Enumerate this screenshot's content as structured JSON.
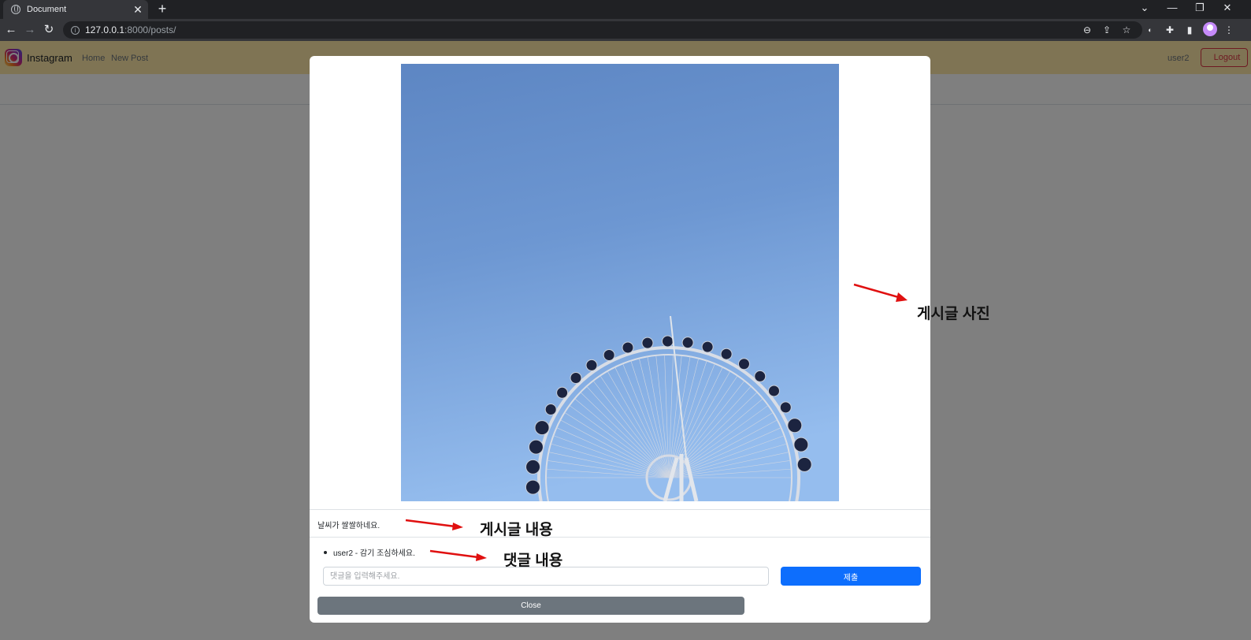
{
  "browser": {
    "tab_title": "Document",
    "tab_close": "✕",
    "new_tab": "+",
    "url_host": "127.0.0.1",
    "url_rest": ":8000/posts/"
  },
  "site": {
    "brand": "Instagram",
    "nav": [
      "Home",
      "New Post"
    ],
    "username": "user2",
    "logout_label": "Logout"
  },
  "modal": {
    "post_content": "날씨가 쌀쌀하네요.",
    "comments": [
      {
        "text": "user2 - 감기 조심하세요."
      }
    ],
    "comment_placeholder": "댓글을 입력해주세요.",
    "submit_label": "제출",
    "close_label": "Close"
  },
  "annotations": {
    "photo": "게시글 사진",
    "content": "게시글 내용",
    "comment": "댓글 내용"
  },
  "colors": {
    "navbar_bg": "#ffe9a8",
    "primary": "#0d6efd",
    "secondary": "#6c757d",
    "danger": "#dc3545",
    "arrow": "#e01010",
    "sky_top": "#5f88c4",
    "sky_bottom": "#8fb9ea"
  }
}
